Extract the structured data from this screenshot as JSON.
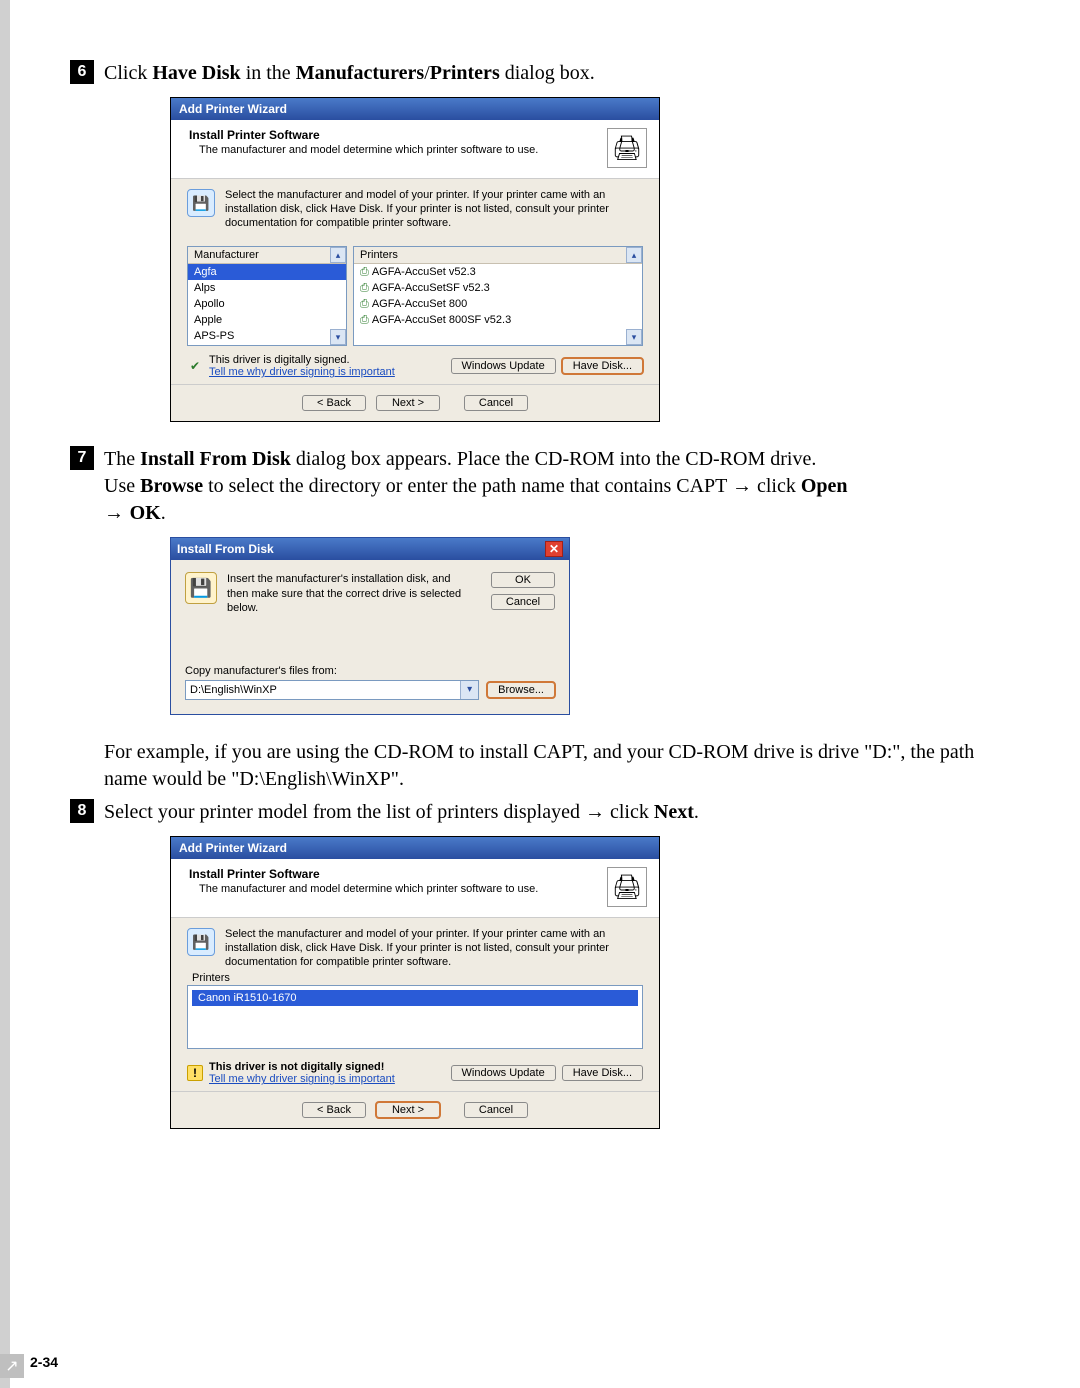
{
  "steps": {
    "s6": {
      "num": "6",
      "text_pre": "Click ",
      "b1": "Have Disk",
      "text_mid": " in the ",
      "b2": "Manufacturers",
      "slash": "/",
      "b3": "Printers",
      "text_post": " dialog box."
    },
    "s7": {
      "num": "7",
      "line1_pre": "The ",
      "line1_b1": "Install From Disk",
      "line1_post": " dialog box appears. Place the CD-ROM into the CD-ROM drive.",
      "line2_pre": "Use ",
      "line2_b1": "Browse",
      "line2_mid": " to select the directory or enter the path name that contains CAPT ",
      "arrow": "→",
      "line2_b2": "Open",
      "line3_arrow": "→ ",
      "line3_b": "OK",
      "line3_dot": "."
    },
    "s7_example": "For example, if you are using the CD-ROM to install CAPT, and your CD-ROM drive is drive \"D:\", the path name would be \"D:\\English\\WinXP\".",
    "s8": {
      "num": "8",
      "pre": "Select your printer model from the list of printers displayed ",
      "arrow": "→",
      "mid": " click ",
      "b": "Next",
      "dot": "."
    }
  },
  "wizard": {
    "title": "Add Printer Wizard",
    "header_title": "Install Printer Software",
    "header_sub": "The manufacturer and model determine which printer software to use.",
    "info": "Select the manufacturer and model of your printer. If your printer came with an installation disk, click Have Disk. If your printer is not listed, consult your printer documentation for compatible printer software.",
    "col_manu": "Manufacturer",
    "col_prn": "Printers",
    "manufacturers": [
      "Agfa",
      "Alps",
      "Apollo",
      "Apple",
      "APS-PS"
    ],
    "printers": [
      "AGFA-AccuSet v52.3",
      "AGFA-AccuSetSF v52.3",
      "AGFA-AccuSet 800",
      "AGFA-AccuSet 800SF v52.3"
    ],
    "signed": "This driver is digitally signed.",
    "not_signed": "This driver is not digitally signed!",
    "link": "Tell me why driver signing is important",
    "btn_wu": "Windows Update",
    "btn_hd": "Have Disk...",
    "btn_back": "< Back",
    "btn_next": "Next >",
    "btn_cancel": "Cancel"
  },
  "disk": {
    "title": "Install From Disk",
    "msg": "Insert the manufacturer's installation disk, and then make sure that the correct drive is selected below.",
    "ok": "OK",
    "cancel": "Cancel",
    "copy_label": "Copy manufacturer's files from:",
    "path": "D:\\English\\WinXP",
    "browse": "Browse..."
  },
  "wizard2": {
    "printers_label": "Printers",
    "printer_item": "Canon iR1510-1670"
  },
  "page_num": "2-34"
}
